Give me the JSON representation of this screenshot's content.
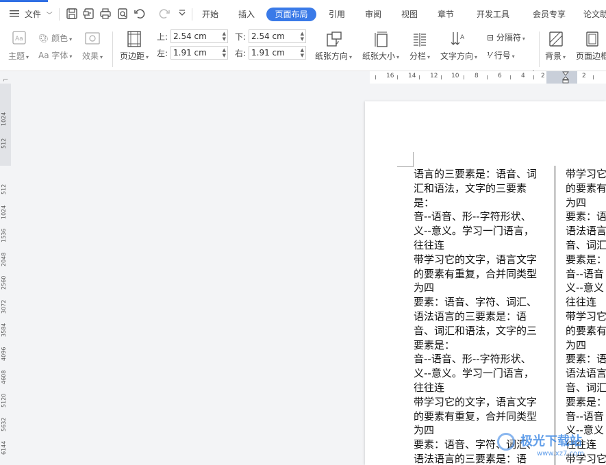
{
  "menubar": {
    "file_label": "文件",
    "tabs": [
      {
        "label": "开始"
      },
      {
        "label": "插入"
      },
      {
        "label": "页面布局",
        "active": true
      },
      {
        "label": "引用"
      },
      {
        "label": "审阅"
      },
      {
        "label": "视图"
      },
      {
        "label": "章节"
      },
      {
        "label": "开发工具"
      },
      {
        "label": "会员专享"
      },
      {
        "label": "论文助手"
      }
    ]
  },
  "ribbon": {
    "theme_label": "主题",
    "color_label": "颜色",
    "font_label": "字体",
    "effect_label": "效果",
    "margins_label": "页边距",
    "top_label": "上:",
    "top_value": "2.54 cm",
    "bottom_label": "下:",
    "bottom_value": "2.54 cm",
    "left_label": "左:",
    "left_value": "1.91 cm",
    "right_label": "右:",
    "right_value": "1.91 cm",
    "orientation_label": "纸张方向",
    "size_label": "纸张大小",
    "columns_label": "分栏",
    "text_direction_label": "文字方向",
    "breaks_label": "分隔符",
    "line_numbers_label": "行号",
    "background_label": "背景",
    "page_border_label": "页面边框"
  },
  "hruler": {
    "labels": [
      "16",
      "14",
      "12",
      "10",
      "8",
      "6",
      "4",
      "2",
      "2"
    ]
  },
  "vruler": {
    "labels": [
      "1024",
      "512",
      "512",
      "1024",
      "1536",
      "2048",
      "2560",
      "3072",
      "3584",
      "4096",
      "4608",
      "5120",
      "5632",
      "6144"
    ]
  },
  "document": {
    "column1": [
      "语言的三要素是：语音、词",
      "汇和语法，文字的三要素",
      "是：",
      "音--语音、形--字符形状、",
      "义--意义。学习一门语言，",
      "往往连",
      "带学习它的文字，语言文字",
      "的要素有重复，合并同类型",
      "为四",
      "要素：语音、字符、词汇、",
      "语法语言的三要素是：语",
      "音、词汇和语法，文字的三",
      "要素是：",
      "音--语音、形--字符形状、",
      "义--意义。学习一门语言，",
      "往往连",
      "带学习它的文字，语言文字",
      "的要素有重复，合并同类型",
      "为四",
      "要素：语音、字符、词汇、",
      "语法语言的三要素是：语"
    ],
    "column2": [
      "带学习它",
      "的要素有",
      "为四",
      "要素：语",
      "语法语言",
      "音、词汇",
      "要素是：",
      "音--语音",
      "义--意义",
      "往往连",
      "带学习它",
      "的要素有",
      "为四",
      "要素：语",
      "语法语言",
      "音、词汇",
      "要素是：",
      "音--语音",
      "义--意义",
      "往往连",
      "带学习它"
    ]
  },
  "watermark": {
    "title": "极光下载站",
    "url": "www.xz7.com"
  }
}
